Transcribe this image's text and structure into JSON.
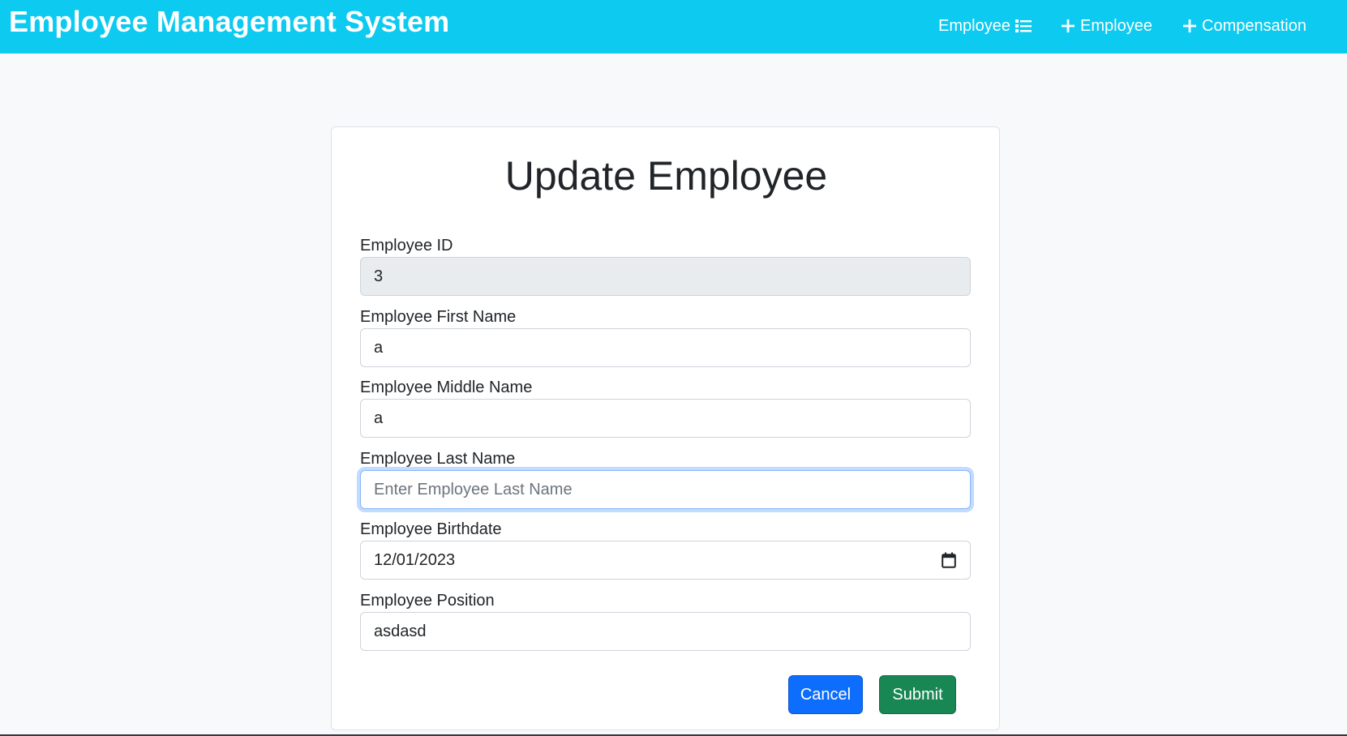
{
  "navbar": {
    "brand": "Employee Management System",
    "links": [
      {
        "label": "Employee",
        "icon": "list-icon"
      },
      {
        "label": "Employee",
        "icon": "plus-icon"
      },
      {
        "label": "Compensation",
        "icon": "plus-icon"
      }
    ],
    "background_color": "#0dcaf0"
  },
  "form": {
    "title": "Update Employee",
    "fields": [
      {
        "label": "Employee ID",
        "value": "3",
        "disabled": true
      },
      {
        "label": "Employee First Name",
        "value": "a"
      },
      {
        "label": "Employee Middle Name",
        "value": "a"
      },
      {
        "label": "Employee Last Name",
        "value": "",
        "placeholder": "Enter Employee Last Name",
        "focused": true
      },
      {
        "label": "Employee Birthdate",
        "value": "12/01/2023",
        "icon": "calendar-icon"
      },
      {
        "label": "Employee Position",
        "value": "asdasd"
      }
    ],
    "buttons": {
      "cancel": "Cancel",
      "submit": "Submit"
    }
  }
}
